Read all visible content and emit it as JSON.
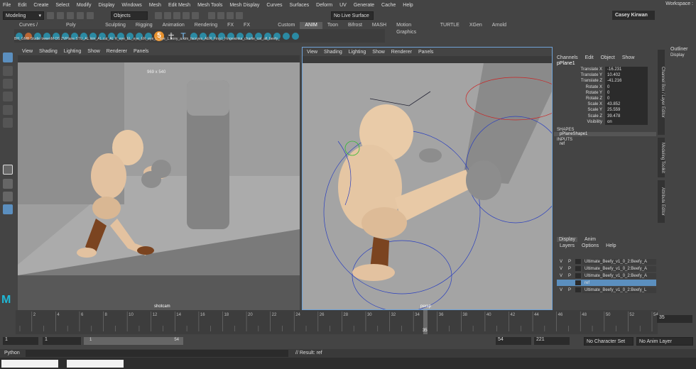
{
  "menubar": {
    "items": [
      "File",
      "Edit",
      "Create",
      "Select",
      "Modify",
      "Display",
      "Windows",
      "Mesh",
      "Edit Mesh",
      "Mesh Tools",
      "Mesh Display",
      "Curves",
      "Surfaces",
      "Deform",
      "UV",
      "Generate",
      "Cache",
      "Help"
    ],
    "workspace": "Workspace :"
  },
  "status": {
    "mode": "Modeling",
    "objects": "Objects",
    "live": "No Live Surface",
    "user": "Casey Kirwan"
  },
  "shelf": {
    "tabs": [
      "Curves / Surfaces",
      "Poly Modeling",
      "Sculpting",
      "Rigging",
      "Animation",
      "Rendering",
      "FX",
      "FX Caching",
      "Custom",
      "ANIM",
      "Toon",
      "Bifrost",
      "MASH",
      "Motion Graphics",
      "TURTLE",
      "XGen",
      "Arnold"
    ],
    "active": "ANIM",
    "labels": "BH_GMH Studio tweenM   OS   ZVPlane   STU_AL.kim_AL.cat_AL   R_eye_EL_eye_ER_eye_L_eye_L.bony_a.kim_faceyes_AER_Fing.l_Fingewinka_charlie_cat_all_beefy_"
  },
  "viewport_left": {
    "menu": [
      "View",
      "Shading",
      "Lighting",
      "Show",
      "Renderer",
      "Panels"
    ],
    "resolution": "969 x 540",
    "camera": "shotcam"
  },
  "viewport_right": {
    "menu": [
      "View",
      "Shading",
      "Lighting",
      "Show",
      "Renderer",
      "Panels"
    ],
    "camera": "persp"
  },
  "channelbox": {
    "menu": [
      "Channels",
      "Edit",
      "Object",
      "Show"
    ],
    "object": "pPlane1",
    "attrs": [
      {
        "name": "Translate X",
        "value": "-16.231"
      },
      {
        "name": "Translate Y",
        "value": "10.402"
      },
      {
        "name": "Translate Z",
        "value": "-41.216"
      },
      {
        "name": "Rotate X",
        "value": "0"
      },
      {
        "name": "Rotate Y",
        "value": "0"
      },
      {
        "name": "Rotate Z",
        "value": "0"
      },
      {
        "name": "Scale X",
        "value": "43.852"
      },
      {
        "name": "Scale Y",
        "value": "25.559"
      },
      {
        "name": "Scale Z",
        "value": "39.478"
      },
      {
        "name": "Visibility",
        "value": "on"
      }
    ],
    "shapes_label": "SHAPES",
    "shape": "pPlaneShape1",
    "inputs_label": "INPUTS",
    "input": "ref"
  },
  "layers": {
    "tabs": [
      "Display",
      "Anim"
    ],
    "menu": [
      "Layers",
      "Options",
      "Help"
    ],
    "rows": [
      {
        "v": "V",
        "p": "P",
        "name": "Ultimate_Beefy_v1_0_2:Beefy_A"
      },
      {
        "v": "V",
        "p": "P",
        "name": "Ultimate_Beefy_v1_0_2:Beefy_A"
      },
      {
        "v": "V",
        "p": "P",
        "name": "Ultimate_Beefy_v1_0_2:Beefy_A"
      },
      {
        "v": "",
        "p": "",
        "name": "ref"
      },
      {
        "v": "V",
        "p": "P",
        "name": "Ultimate_Beefy_v1_0_2:Beefy_L"
      }
    ]
  },
  "timeline": {
    "ticks": [
      "2",
      "4",
      "6",
      "8",
      "10",
      "12",
      "14",
      "16",
      "18",
      "20",
      "22",
      "24",
      "26",
      "28",
      "30",
      "32",
      "34",
      "36",
      "38",
      "40",
      "42",
      "44",
      "46",
      "48",
      "50",
      "52",
      "54"
    ],
    "current": "35",
    "current_field": "35"
  },
  "range": {
    "start": "1",
    "start2": "1",
    "slider_start": "1",
    "slider_end": "54",
    "end": "54",
    "end2": "221",
    "charset": "No Character Set",
    "animlayer": "No Anim Layer"
  },
  "cmd": {
    "lang": "Python",
    "result": "// Result: ref"
  },
  "right_tabs": [
    "Outliner",
    "Display",
    "Channel Box / Layer Editor",
    "Modeling Toolkit",
    "Attribute Editor"
  ]
}
